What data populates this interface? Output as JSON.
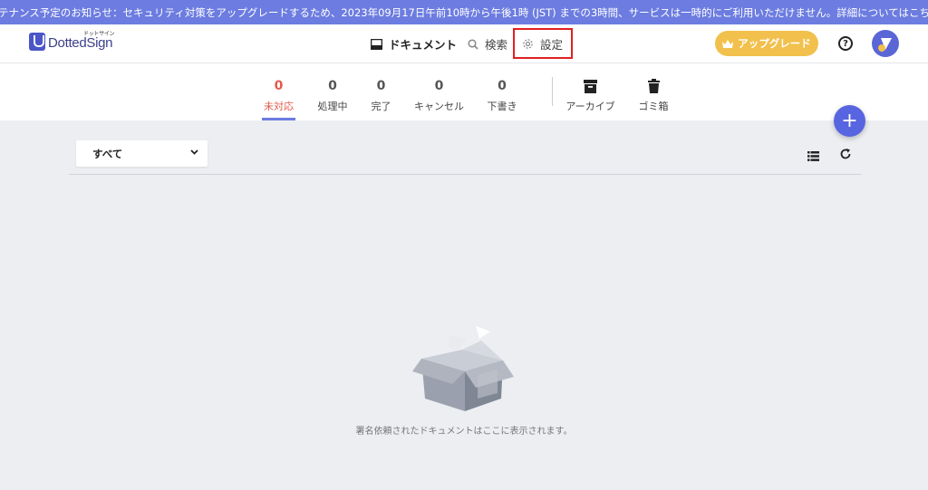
{
  "banner": {
    "text": "メンテナンス予定のお知らせ：セキュリティ対策をアップグレードするため、2023年09月17日午前10時から午後1時 (JST) までの3時間、サービスは一時的にご利用いただけません。詳細についてはこちら。"
  },
  "header": {
    "logo_text": "DottedSign",
    "logo_sub": "ドットサイン",
    "nav": {
      "documents": "ドキュメント",
      "search": "検索",
      "settings": "設定"
    },
    "upgrade_label": "アップグレード",
    "help_label": "?"
  },
  "tabs": [
    {
      "count": "0",
      "label": "未対応"
    },
    {
      "count": "0",
      "label": "処理中"
    },
    {
      "count": "0",
      "label": "完了"
    },
    {
      "count": "0",
      "label": "キャンセル"
    },
    {
      "count": "0",
      "label": "下書き"
    },
    {
      "label": "アーカイブ"
    },
    {
      "label": "ゴミ箱"
    }
  ],
  "fab_label": "+",
  "filter": {
    "selected": "すべて"
  },
  "empty": {
    "message": "署名依頼されたドキュメントはここに表示されます。"
  },
  "colors": {
    "accent": "#6c7ce0",
    "active_tab": "#e35a4b",
    "upgrade": "#f2c04c",
    "highlight": "#e02020"
  }
}
